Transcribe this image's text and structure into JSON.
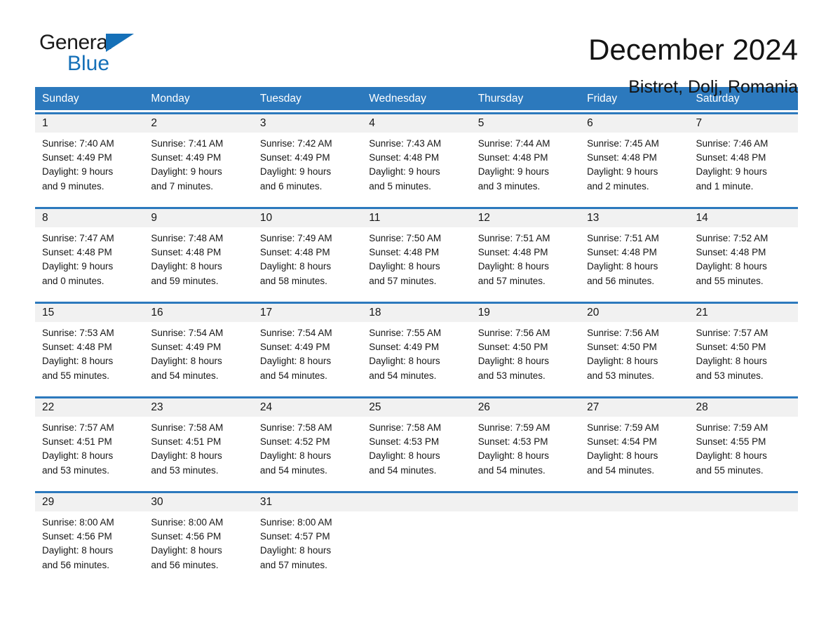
{
  "logo": {
    "word_one": "General",
    "word_two": "Blue",
    "triangle_color": "#1570b8",
    "icon": "triangle-icon"
  },
  "header": {
    "title": "December 2024",
    "subtitle": "Bistret, Dolj, Romania"
  },
  "colors": {
    "header_blue": "#2c79bd",
    "daynum_band": "#f1f1f1",
    "text": "#161616"
  },
  "calendar": {
    "weekday_headers": [
      "Sunday",
      "Monday",
      "Tuesday",
      "Wednesday",
      "Thursday",
      "Friday",
      "Saturday"
    ],
    "weeks": [
      {
        "days": [
          {
            "num": "1",
            "sunrise": "Sunrise: 7:40 AM",
            "sunset": "Sunset: 4:49 PM",
            "daylight_line1": "Daylight: 9 hours",
            "daylight_line2": "and 9 minutes."
          },
          {
            "num": "2",
            "sunrise": "Sunrise: 7:41 AM",
            "sunset": "Sunset: 4:49 PM",
            "daylight_line1": "Daylight: 9 hours",
            "daylight_line2": "and 7 minutes."
          },
          {
            "num": "3",
            "sunrise": "Sunrise: 7:42 AM",
            "sunset": "Sunset: 4:49 PM",
            "daylight_line1": "Daylight: 9 hours",
            "daylight_line2": "and 6 minutes."
          },
          {
            "num": "4",
            "sunrise": "Sunrise: 7:43 AM",
            "sunset": "Sunset: 4:48 PM",
            "daylight_line1": "Daylight: 9 hours",
            "daylight_line2": "and 5 minutes."
          },
          {
            "num": "5",
            "sunrise": "Sunrise: 7:44 AM",
            "sunset": "Sunset: 4:48 PM",
            "daylight_line1": "Daylight: 9 hours",
            "daylight_line2": "and 3 minutes."
          },
          {
            "num": "6",
            "sunrise": "Sunrise: 7:45 AM",
            "sunset": "Sunset: 4:48 PM",
            "daylight_line1": "Daylight: 9 hours",
            "daylight_line2": "and 2 minutes."
          },
          {
            "num": "7",
            "sunrise": "Sunrise: 7:46 AM",
            "sunset": "Sunset: 4:48 PM",
            "daylight_line1": "Daylight: 9 hours",
            "daylight_line2": "and 1 minute."
          }
        ]
      },
      {
        "days": [
          {
            "num": "8",
            "sunrise": "Sunrise: 7:47 AM",
            "sunset": "Sunset: 4:48 PM",
            "daylight_line1": "Daylight: 9 hours",
            "daylight_line2": "and 0 minutes."
          },
          {
            "num": "9",
            "sunrise": "Sunrise: 7:48 AM",
            "sunset": "Sunset: 4:48 PM",
            "daylight_line1": "Daylight: 8 hours",
            "daylight_line2": "and 59 minutes."
          },
          {
            "num": "10",
            "sunrise": "Sunrise: 7:49 AM",
            "sunset": "Sunset: 4:48 PM",
            "daylight_line1": "Daylight: 8 hours",
            "daylight_line2": "and 58 minutes."
          },
          {
            "num": "11",
            "sunrise": "Sunrise: 7:50 AM",
            "sunset": "Sunset: 4:48 PM",
            "daylight_line1": "Daylight: 8 hours",
            "daylight_line2": "and 57 minutes."
          },
          {
            "num": "12",
            "sunrise": "Sunrise: 7:51 AM",
            "sunset": "Sunset: 4:48 PM",
            "daylight_line1": "Daylight: 8 hours",
            "daylight_line2": "and 57 minutes."
          },
          {
            "num": "13",
            "sunrise": "Sunrise: 7:51 AM",
            "sunset": "Sunset: 4:48 PM",
            "daylight_line1": "Daylight: 8 hours",
            "daylight_line2": "and 56 minutes."
          },
          {
            "num": "14",
            "sunrise": "Sunrise: 7:52 AM",
            "sunset": "Sunset: 4:48 PM",
            "daylight_line1": "Daylight: 8 hours",
            "daylight_line2": "and 55 minutes."
          }
        ]
      },
      {
        "days": [
          {
            "num": "15",
            "sunrise": "Sunrise: 7:53 AM",
            "sunset": "Sunset: 4:48 PM",
            "daylight_line1": "Daylight: 8 hours",
            "daylight_line2": "and 55 minutes."
          },
          {
            "num": "16",
            "sunrise": "Sunrise: 7:54 AM",
            "sunset": "Sunset: 4:49 PM",
            "daylight_line1": "Daylight: 8 hours",
            "daylight_line2": "and 54 minutes."
          },
          {
            "num": "17",
            "sunrise": "Sunrise: 7:54 AM",
            "sunset": "Sunset: 4:49 PM",
            "daylight_line1": "Daylight: 8 hours",
            "daylight_line2": "and 54 minutes."
          },
          {
            "num": "18",
            "sunrise": "Sunrise: 7:55 AM",
            "sunset": "Sunset: 4:49 PM",
            "daylight_line1": "Daylight: 8 hours",
            "daylight_line2": "and 54 minutes."
          },
          {
            "num": "19",
            "sunrise": "Sunrise: 7:56 AM",
            "sunset": "Sunset: 4:50 PM",
            "daylight_line1": "Daylight: 8 hours",
            "daylight_line2": "and 53 minutes."
          },
          {
            "num": "20",
            "sunrise": "Sunrise: 7:56 AM",
            "sunset": "Sunset: 4:50 PM",
            "daylight_line1": "Daylight: 8 hours",
            "daylight_line2": "and 53 minutes."
          },
          {
            "num": "21",
            "sunrise": "Sunrise: 7:57 AM",
            "sunset": "Sunset: 4:50 PM",
            "daylight_line1": "Daylight: 8 hours",
            "daylight_line2": "and 53 minutes."
          }
        ]
      },
      {
        "days": [
          {
            "num": "22",
            "sunrise": "Sunrise: 7:57 AM",
            "sunset": "Sunset: 4:51 PM",
            "daylight_line1": "Daylight: 8 hours",
            "daylight_line2": "and 53 minutes."
          },
          {
            "num": "23",
            "sunrise": "Sunrise: 7:58 AM",
            "sunset": "Sunset: 4:51 PM",
            "daylight_line1": "Daylight: 8 hours",
            "daylight_line2": "and 53 minutes."
          },
          {
            "num": "24",
            "sunrise": "Sunrise: 7:58 AM",
            "sunset": "Sunset: 4:52 PM",
            "daylight_line1": "Daylight: 8 hours",
            "daylight_line2": "and 54 minutes."
          },
          {
            "num": "25",
            "sunrise": "Sunrise: 7:58 AM",
            "sunset": "Sunset: 4:53 PM",
            "daylight_line1": "Daylight: 8 hours",
            "daylight_line2": "and 54 minutes."
          },
          {
            "num": "26",
            "sunrise": "Sunrise: 7:59 AM",
            "sunset": "Sunset: 4:53 PM",
            "daylight_line1": "Daylight: 8 hours",
            "daylight_line2": "and 54 minutes."
          },
          {
            "num": "27",
            "sunrise": "Sunrise: 7:59 AM",
            "sunset": "Sunset: 4:54 PM",
            "daylight_line1": "Daylight: 8 hours",
            "daylight_line2": "and 54 minutes."
          },
          {
            "num": "28",
            "sunrise": "Sunrise: 7:59 AM",
            "sunset": "Sunset: 4:55 PM",
            "daylight_line1": "Daylight: 8 hours",
            "daylight_line2": "and 55 minutes."
          }
        ]
      },
      {
        "days": [
          {
            "num": "29",
            "sunrise": "Sunrise: 8:00 AM",
            "sunset": "Sunset: 4:56 PM",
            "daylight_line1": "Daylight: 8 hours",
            "daylight_line2": "and 56 minutes."
          },
          {
            "num": "30",
            "sunrise": "Sunrise: 8:00 AM",
            "sunset": "Sunset: 4:56 PM",
            "daylight_line1": "Daylight: 8 hours",
            "daylight_line2": "and 56 minutes."
          },
          {
            "num": "31",
            "sunrise": "Sunrise: 8:00 AM",
            "sunset": "Sunset: 4:57 PM",
            "daylight_line1": "Daylight: 8 hours",
            "daylight_line2": "and 57 minutes."
          },
          {
            "num": "",
            "sunrise": "",
            "sunset": "",
            "daylight_line1": "",
            "daylight_line2": ""
          },
          {
            "num": "",
            "sunrise": "",
            "sunset": "",
            "daylight_line1": "",
            "daylight_line2": ""
          },
          {
            "num": "",
            "sunrise": "",
            "sunset": "",
            "daylight_line1": "",
            "daylight_line2": ""
          },
          {
            "num": "",
            "sunrise": "",
            "sunset": "",
            "daylight_line1": "",
            "daylight_line2": ""
          }
        ]
      }
    ]
  }
}
